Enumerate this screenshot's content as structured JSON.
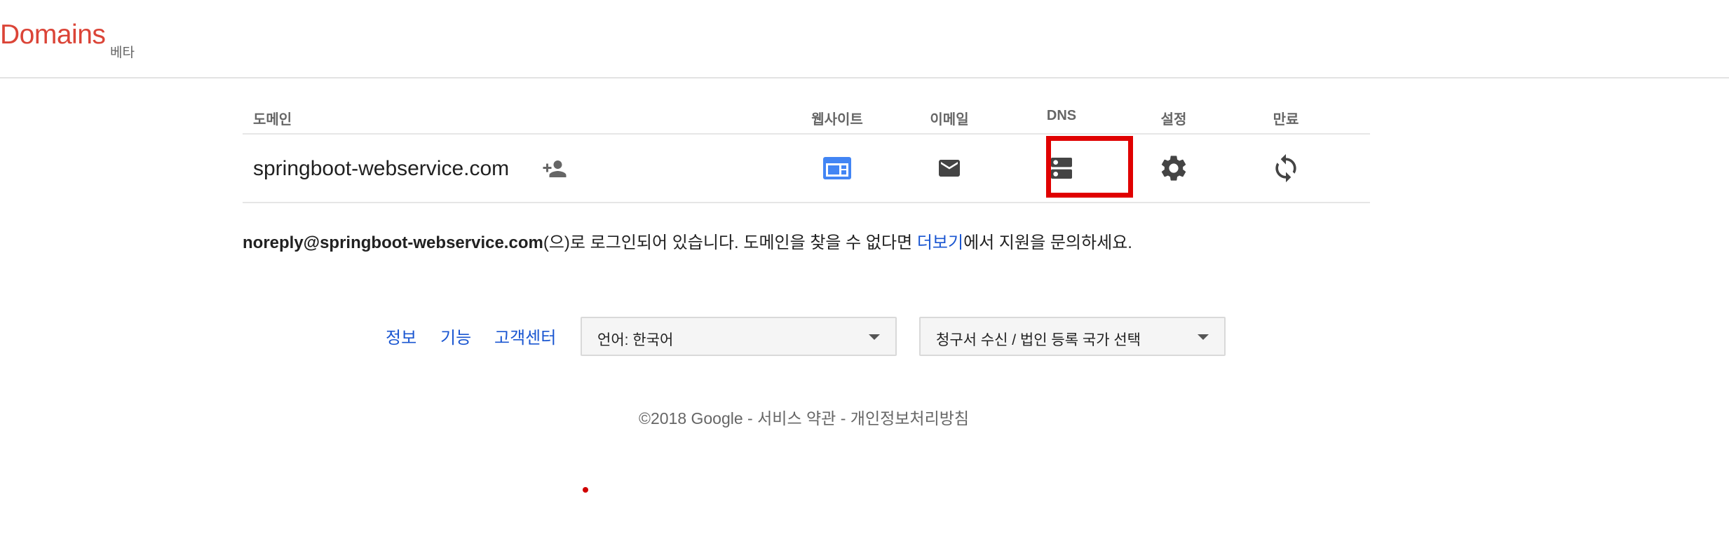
{
  "header": {
    "logo_text": "Domains",
    "beta_label": "베타"
  },
  "table": {
    "headers": {
      "domain": "도메인",
      "website": "웹사이트",
      "email": "이메일",
      "dns": "DNS",
      "settings": "설정",
      "expiry": "만료"
    },
    "row": {
      "domain": "springboot-webservice.com"
    },
    "icons": [
      "share-user-icon",
      "website-icon",
      "email-icon",
      "dns-icon",
      "gear-icon",
      "renew-icon"
    ],
    "highlight_color": "#e00000"
  },
  "notice": {
    "email": "noreply@springboot-webservice.com",
    "text_1": "(으)로 로그인되어 있습니다. 도메인을 찾을 수 없다면 ",
    "link": "더보기",
    "text_2": "에서 지원을 문의하세요."
  },
  "footer": {
    "links": [
      "정보",
      "기능",
      "고객센터"
    ],
    "language_select": "언어: 한국어",
    "country_select": "청구서 수신 / 법인 등록 국가 선택",
    "copyright": "©2018 Google",
    "sep": " - ",
    "terms": "서비스 약관",
    "privacy": "개인정보처리방침"
  },
  "colors": {
    "brand": "#db4437",
    "link": "#1a56d1",
    "icon_blue": "#4285f4",
    "icon_gray": "#444444"
  }
}
